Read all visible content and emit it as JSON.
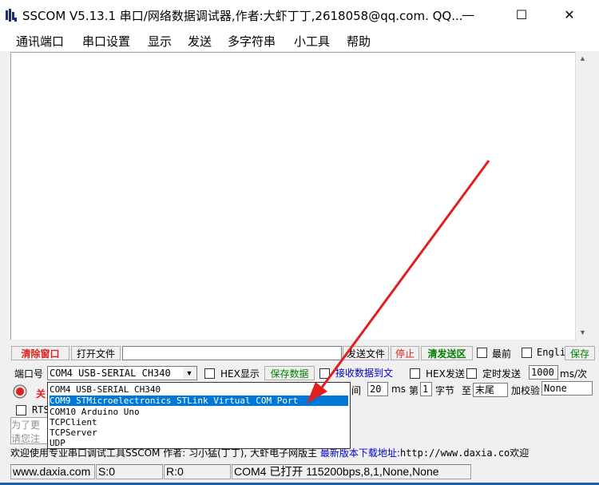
{
  "window": {
    "title": "SSCOM V5.13.1 串口/网络数据调试器,作者:大虾丁丁,2618058@qq.com. QQ...",
    "minimize_glyph": "—",
    "maximize_glyph": "☐",
    "close_glyph": "✕"
  },
  "menu": [
    "通讯端口",
    "串口设置",
    "显示",
    "发送",
    "多字符串",
    "小工具",
    "帮助"
  ],
  "toolbar1": {
    "clear_window": "清除窗口",
    "open_file": "打开文件",
    "send_file": "发送文件",
    "stop": "停止",
    "clear_send": "清发送区",
    "topmost": "最前",
    "english": "Engli",
    "save": "保存"
  },
  "toolbar2": {
    "port_label": "端口号",
    "port_value": "COM4 USB-SERIAL CH340",
    "hex_display": "HEX显示",
    "save_data": "保存数据",
    "recv_to_file": "接收数据到文",
    "hex_send": "HEX发送",
    "timed_send": "定时发送",
    "interval_value": "1000",
    "interval_unit": "ms/次"
  },
  "toolbar3": {
    "close_label": "关",
    "interval_label": "间",
    "interval_value": "20",
    "ms_label": "ms",
    "order_label": "第",
    "byte_value": "1",
    "byte_label": "字节",
    "to_label": "至",
    "end_value": "末尾",
    "checksum_label": "加校验",
    "checksum_value": "None"
  },
  "rts_label": "RTS",
  "side_hint": [
    "为了更",
    "请您注"
  ],
  "port_dropdown": {
    "items": [
      "COM4 USB-SERIAL CH340",
      "COM9 STMicroelectronics STLink Virtual COM Port",
      "COM10 Arduino Uno",
      "TCPClient",
      "TCPServer",
      "UDP"
    ],
    "selected_index": 1
  },
  "info_line": {
    "text": "欢迎使用专业串口调试工具SSCOM  作者: 习小猛(丁丁), 大虾电子网版主  ",
    "link": "最新版本下载地址:",
    "url": "http://www.daxia.co",
    "tail": "欢迎"
  },
  "status": {
    "site": "www.daxia.com",
    "sent": "S:0",
    "received": "R:0",
    "port_state": "COM4 已打开  115200bps,8,1,None,None"
  },
  "colors": {
    "accent_red": "#e02020",
    "green_button_text": "#008000",
    "blue_link": "#0000cc",
    "selection": "#0078d7"
  }
}
